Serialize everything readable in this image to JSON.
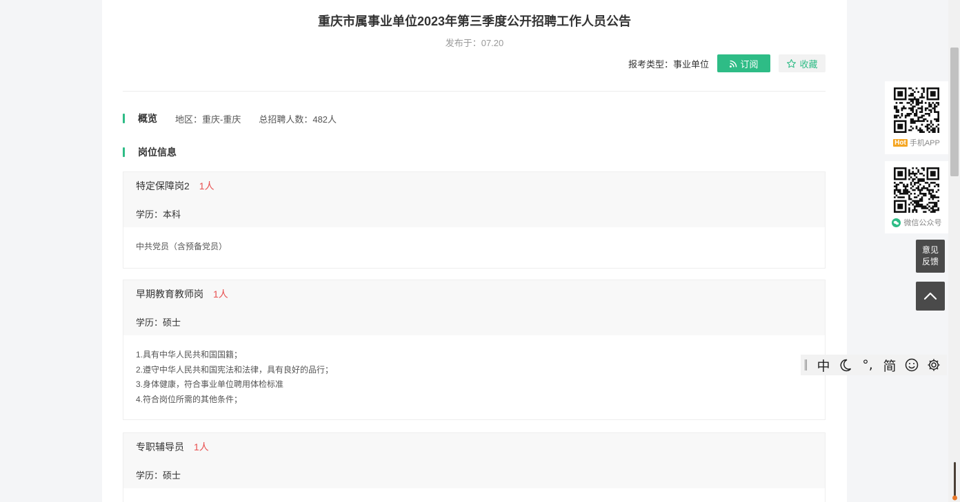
{
  "article": {
    "title": "重庆市属事业单位2023年第三季度公开招聘工作人员公告",
    "published": "发布于：07.20",
    "type_label": "报考类型：事业单位",
    "subscribe_label": "订阅",
    "favorite_label": "收藏"
  },
  "overview": {
    "heading": "概览",
    "region": "地区：重庆-重庆",
    "total": "总招聘人数：482人"
  },
  "positions": {
    "heading": "岗位信息",
    "items": [
      {
        "name": "特定保障岗2",
        "count": "1人",
        "education": "学历：本科",
        "requirements": [
          "中共党员（含预备党员）"
        ]
      },
      {
        "name": "早期教育教师岗",
        "count": "1人",
        "education": "学历：硕士",
        "requirements": [
          "1.具有中华人民共和国国籍；",
          "2.遵守中华人民共和国宪法和法律，具有良好的品行；",
          "3.身体健康，符合事业单位聘用体检标准",
          "4.符合岗位所需的其他条件；"
        ]
      },
      {
        "name": "专职辅导员",
        "count": "1人",
        "education": "学历：硕士",
        "requirements": []
      }
    ]
  },
  "sidebar": {
    "app_hot": "Hot",
    "app_label": "手机APP",
    "wechat_label": "微信公众号",
    "feedback_line1": "意见",
    "feedback_line2": "反馈"
  },
  "ime": {
    "chinese": "中",
    "punct": "°,",
    "simplified": "简"
  },
  "icons": [
    "rss-icon",
    "star-icon",
    "wechat-icon",
    "chevron-up-icon",
    "moon-icon",
    "smiley-icon",
    "gear-icon"
  ],
  "colors": {
    "accent": "#2ebc86",
    "count": "#e84f4f",
    "hot": "#f5a623",
    "dark_button": "#4a4a4a"
  }
}
